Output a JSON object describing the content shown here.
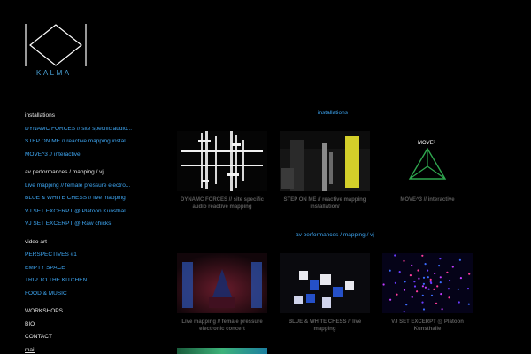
{
  "brand": {
    "name": "KALMA"
  },
  "sidebar": {
    "installations": {
      "title": "installations",
      "items": [
        "DYNAMC FORCES // site specific audio...",
        "STEP ON ME // reactive mapping instal...",
        "MOVE^3 // interactive"
      ]
    },
    "av": {
      "title": "av performances / mapping / vj",
      "items": [
        "Live mapping // female pressure electro...",
        "BLUE & WHITE CHESS // live mapping",
        "VJ SET EXCERPT @ Platoon Kunsthal...",
        "VJ SET EXCERPT @ Raw chicks"
      ]
    },
    "video": {
      "title": "video art",
      "items": [
        "PERSPECTIVES #1",
        "EMPTY SPACE",
        "TRIP TO THE KITCHEN",
        "FOOD & MUSIC"
      ]
    },
    "footer": [
      "WORKSHOPS",
      "BIO",
      "CONTACT"
    ],
    "mail": "mail"
  },
  "main": {
    "installations_heading": "installations",
    "av_heading": "av performances / mapping / vj",
    "installations": [
      {
        "caption": "DYNAMC FORCES // site specific audio reactive mapping"
      },
      {
        "caption": "STEP ON ME // reactive mapping installation/"
      },
      {
        "caption": "MOVE^3 // interactive",
        "thumb_label": "MOVE³"
      }
    ],
    "av": [
      {
        "caption": "Live mapping // female pressure electronic concert"
      },
      {
        "caption": "BLUE & WHITE CHESS // live mapping"
      },
      {
        "caption": "VJ SET EXCERPT @ Platoon Kunsthalle"
      }
    ]
  },
  "colors": {
    "link": "#3ea6f2",
    "caption": "#5c5c5c",
    "background": "#000000"
  }
}
